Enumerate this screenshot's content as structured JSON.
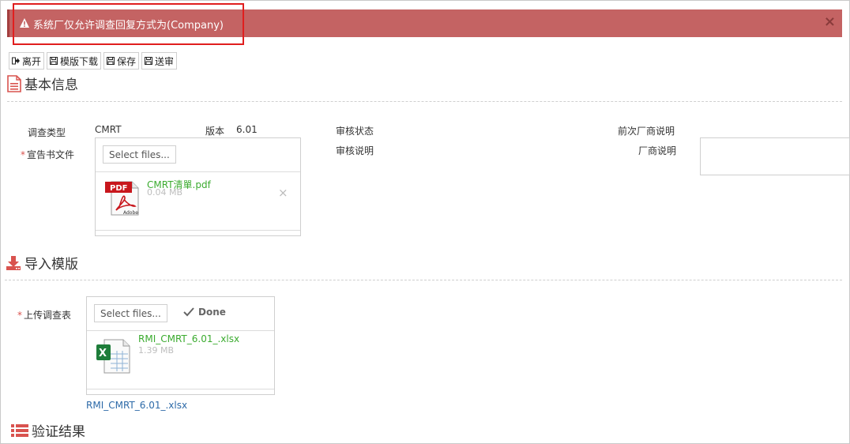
{
  "alert": {
    "message": "系统厂仅允许调查回复方式为(Company)",
    "close": "×",
    "icon": "warning-icon"
  },
  "toolbar": {
    "leave": "离开",
    "template_download": "模版下载",
    "save": "保存",
    "submit": "送审"
  },
  "sections": {
    "basic_info": "基本信息",
    "import_template": "导入模版",
    "verify_result": "验证结果"
  },
  "basic": {
    "survey_type_label": "调查类型",
    "survey_type_value": "CMRT",
    "version_label": "版本",
    "version_value": "6.01",
    "declaration_label": "宣告书文件",
    "audit_status_label": "审核状态",
    "audit_note_label": "审核说明",
    "prev_vendor_note_label": "前次厂商说明",
    "vendor_note_label": "厂商说明",
    "vendor_note_value": ""
  },
  "declaration_upload": {
    "select_label": "Select files...",
    "file_name": "CMRT清單.pdf",
    "file_size": "0.04 MB",
    "remove": "×"
  },
  "import": {
    "upload_label": "上传调查表",
    "select_label": "Select files...",
    "done_label": "Done",
    "file_name": "RMI_CMRT_6.01_.xlsx",
    "file_size": "1.39 MB",
    "link_text": "RMI_CMRT_6.01_.xlsx"
  },
  "required_mark": "*",
  "colors": {
    "alert_bg": "#c46363",
    "accent": "#d9534f",
    "file_green": "#3bab2f",
    "link_blue": "#2d6aa8"
  }
}
